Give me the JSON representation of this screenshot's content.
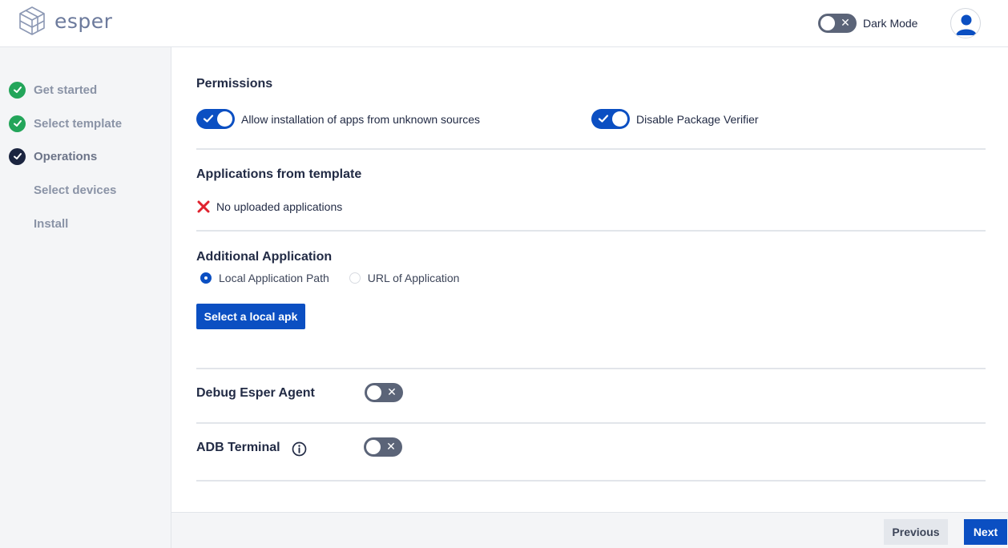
{
  "header": {
    "logo_text": "esper",
    "dark_mode_label": "Dark Mode",
    "dark_mode_on": false
  },
  "sidebar": {
    "steps": [
      {
        "label": "Get started",
        "status": "done"
      },
      {
        "label": "Select template",
        "status": "done"
      },
      {
        "label": "Operations",
        "status": "current"
      },
      {
        "label": "Select devices",
        "status": "pending"
      },
      {
        "label": "Install",
        "status": "pending"
      }
    ]
  },
  "permissions": {
    "title": "Permissions",
    "items": [
      {
        "label": "Allow installation of apps from unknown sources",
        "enabled": true
      },
      {
        "label": "Disable Package Verifier",
        "enabled": true
      }
    ]
  },
  "template_apps": {
    "title": "Applications from template",
    "empty_message": "No uploaded applications"
  },
  "additional_app": {
    "title": "Additional Application",
    "options": [
      {
        "label": "Local Application Path",
        "selected": true
      },
      {
        "label": "URL of Application",
        "selected": false
      }
    ],
    "select_button": "Select a local apk"
  },
  "debug_agent": {
    "label": "Debug Esper Agent",
    "enabled": false
  },
  "adb_terminal": {
    "label": "ADB Terminal",
    "enabled": false
  },
  "footer": {
    "previous_label": "Previous",
    "next_label": "Next"
  },
  "colors": {
    "primary": "#0b4fc2",
    "success": "#23a55a",
    "error": "#e0222e",
    "toggle_off": "#5b6478"
  },
  "icons": {
    "logo": "esper-cube-icon",
    "avatar": "user-avatar-icon",
    "done": "check-circle-icon",
    "error": "x-mark-icon",
    "info": "info-circle-icon"
  }
}
